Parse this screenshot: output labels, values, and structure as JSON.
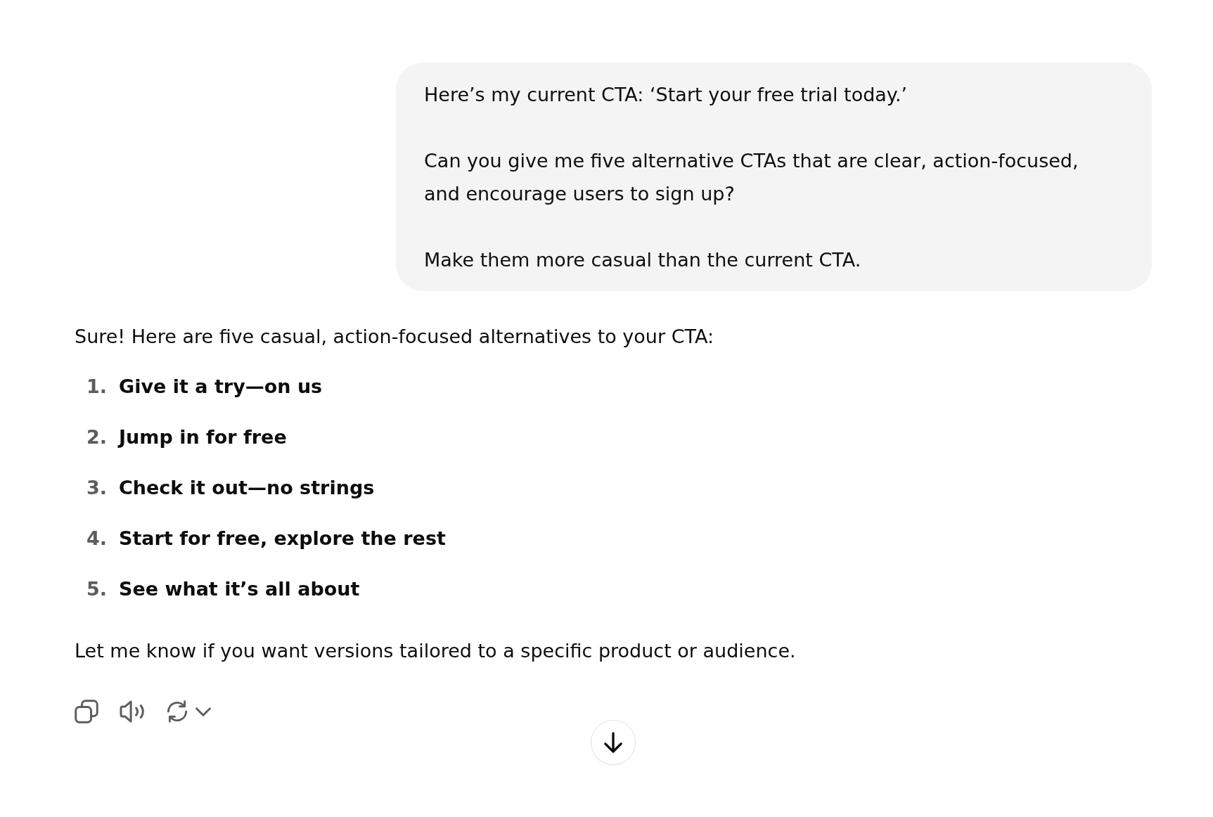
{
  "user_message": {
    "paragraphs": [
      "Here’s my current CTA: ‘Start your free trial today.’",
      "Can you give me five alternative CTAs that are clear, action-focused, and encourage users to sign up?",
      "Make them more casual than the current CTA."
    ]
  },
  "assistant_message": {
    "intro": "Sure! Here are five casual, action-focused alternatives to your CTA:",
    "suggestions": [
      {
        "number": "1.",
        "text": "Give it a try—on us"
      },
      {
        "number": "2.",
        "text": "Jump in for free"
      },
      {
        "number": "3.",
        "text": "Check it out—no strings"
      },
      {
        "number": "4.",
        "text": "Start for free, explore the rest"
      },
      {
        "number": "5.",
        "text": "See what it’s all about"
      }
    ],
    "closing": "Let me know if you want versions tailored to a specific product or audience."
  }
}
